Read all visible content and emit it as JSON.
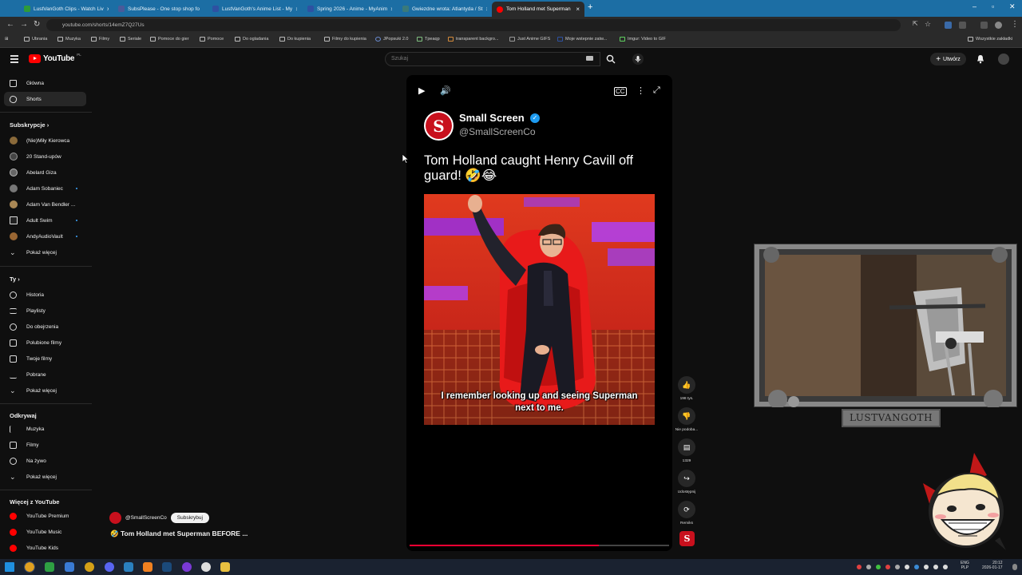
{
  "browser": {
    "tabs": [
      {
        "label": "LustVanGoth Clips - Watch Liv",
        "color": "#2e9b3a"
      },
      {
        "label": "SubsPlease - One stop shop fo",
        "color": "#4a5a9a"
      },
      {
        "label": "LustVanGoth's Anime List - My",
        "color": "#2e51a2"
      },
      {
        "label": "Spring 2026 - Anime - MyAnim",
        "color": "#2e51a2"
      },
      {
        "label": "Gwiezdne wrota: Atlantyda / St",
        "color": "#3a7a7a"
      },
      {
        "label": "Tom Holland met Superman",
        "color": "#ff0000"
      }
    ],
    "url": "youtube.com/shorts/14emZ7Q27Us",
    "bookmarks": [
      "Ubrania",
      "Muzyka",
      "Filmy",
      "Seriale",
      "Pomoce do gier",
      "Pomoce",
      "Do ogladania",
      "Do kupienia",
      "Filmy do kupienia",
      "JPopsuki 2.0",
      "Tpeaqp",
      "transparent backgro...",
      "Just Anime GIFS",
      "Moje wstepnie zatw...",
      "Imgur: Video to GIF"
    ],
    "all_bookmarks": "Wszystkie zakładki"
  },
  "header": {
    "logo": "YouTube",
    "country": "PL",
    "search_placeholder": "Szukaj",
    "create_label": "Utwórz"
  },
  "sidebar": {
    "main": [
      {
        "label": "Główna"
      },
      {
        "label": "Shorts"
      }
    ],
    "subs_heading": "Subskrypcje",
    "subscriptions": [
      {
        "label": "(Nie)Miły Kierowca",
        "color": "#8a6a3a",
        "dot": false
      },
      {
        "label": "20 Stand-upów",
        "color": "#444444",
        "dot": false
      },
      {
        "label": "Abelard Giza",
        "color": "#666666",
        "dot": false
      },
      {
        "label": "Adam Sobaniec",
        "color": "#777777",
        "dot": true
      },
      {
        "label": "Adam Van Bendler ...",
        "color": "#aa8855",
        "dot": false
      },
      {
        "label": "Adult Swim",
        "color": "#222222",
        "dot": true
      },
      {
        "label": "AndyAudioVault",
        "color": "#996633",
        "dot": true
      }
    ],
    "show_more": "Pokaż więcej",
    "you_heading": "Ty",
    "you": [
      {
        "label": "Historia"
      },
      {
        "label": "Playlisty"
      },
      {
        "label": "Do obejrzenia"
      },
      {
        "label": "Polubione filmy"
      },
      {
        "label": "Twoje filmy"
      },
      {
        "label": "Pobrane"
      },
      {
        "label": "Pokaż więcej"
      }
    ],
    "explore_heading": "Odkrywaj",
    "explore": [
      {
        "label": "Muzyka"
      },
      {
        "label": "Filmy"
      },
      {
        "label": "Na żywo"
      },
      {
        "label": "Pokaż więcej"
      }
    ],
    "more_heading": "Więcej z YouTube",
    "more": [
      {
        "label": "YouTube Premium"
      },
      {
        "label": "YouTube Music"
      },
      {
        "label": "YouTube Kids"
      }
    ]
  },
  "short": {
    "channel": "@SmallScreenCo",
    "subscribe_label": "Subskrybuj",
    "title": "🤣 Tom Holland met Superman BEFORE ...",
    "progress": 0.73
  },
  "video": {
    "tweet_name": "Small Screen",
    "tweet_handle": "@SmallScreenCo",
    "tweet_text": "Tom Holland caught Henry Cavill off guard! 🤣😂",
    "logo_letter": "S",
    "subtitle_line1": "I remember looking up and seeing Superman",
    "subtitle_line2": "next to me."
  },
  "actions": [
    {
      "label": "198 tys.",
      "icon": "thumbs-up-icon"
    },
    {
      "label": "Nie podoba...",
      "icon": "thumbs-down-icon"
    },
    {
      "label": "1329",
      "icon": "comment-icon"
    },
    {
      "label": "Udostępnij",
      "icon": "share-icon"
    },
    {
      "label": "Remiks",
      "icon": "remix-icon"
    }
  ],
  "overlay": {
    "cam_label": "LUSTVANGOTH"
  },
  "taskbar": {
    "lang1": "ENG",
    "lang2": "PLP",
    "time": "20:12",
    "date": "2026-01-17"
  }
}
